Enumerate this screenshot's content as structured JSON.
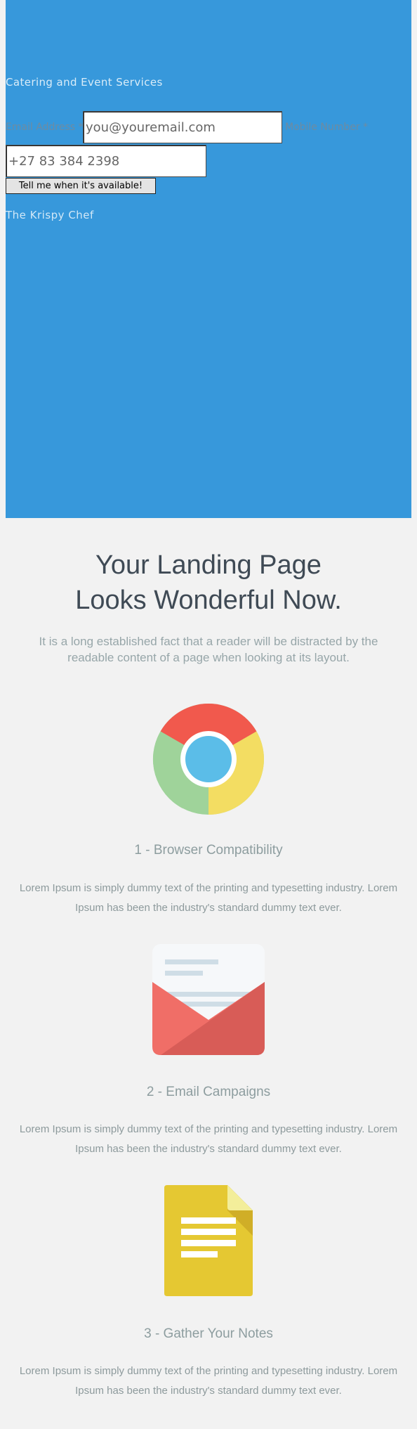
{
  "hero": {
    "tagline": "Catering and Event Services",
    "email_label": "Email Address *",
    "email_placeholder": "you@youremail.com",
    "mobile_label": "Mobile Number *",
    "mobile_placeholder": "+27 83 384 2398",
    "submit_label": "Tell me when it's available!",
    "brand": "The Krispy Chef",
    "background_color": "#3798db"
  },
  "intro": {
    "headline_line1": "Your Landing Page",
    "headline_line2": "Looks Wonderful Now.",
    "lead": "It is a long established fact that a reader will be distracted by the readable content of a page when looking at its layout."
  },
  "features": [
    {
      "icon": "chrome-icon",
      "title": "1 - Browser Compatibility",
      "text": "Lorem Ipsum is simply dummy text of the printing and typesetting industry. Lorem Ipsum has been the industry's standard dummy text ever."
    },
    {
      "icon": "envelope-icon",
      "title": "2 - Email Campaigns",
      "text": "Lorem Ipsum is simply dummy text of the printing and typesetting industry. Lorem Ipsum has been the industry's standard dummy text ever."
    },
    {
      "icon": "document-icon",
      "title": "3 - Gather Your Notes",
      "text": "Lorem Ipsum is simply dummy text of the printing and typesetting industry. Lorem Ipsum has been the industry's standard dummy text ever."
    }
  ]
}
